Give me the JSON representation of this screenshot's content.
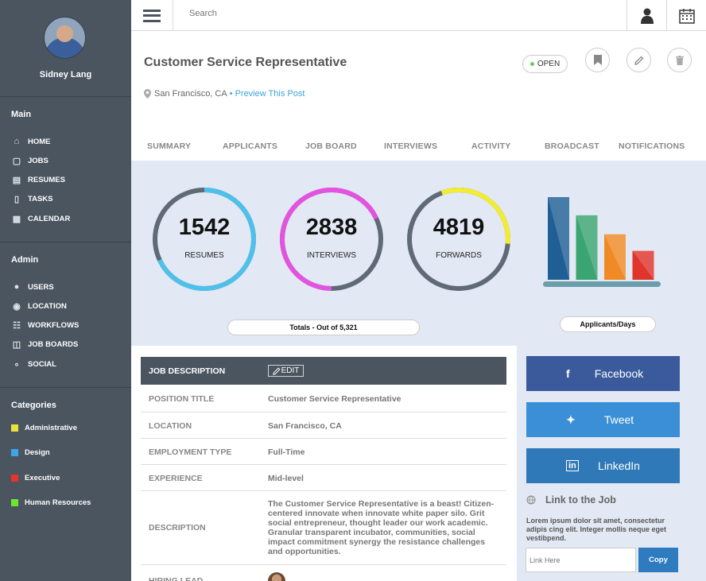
{
  "sidebar": {
    "profile_name": "Sidney Lang",
    "main_title": "Main",
    "main_items": [
      {
        "label": "HOME",
        "icon": "home-icon"
      },
      {
        "label": "JOBS",
        "icon": "briefcase-icon"
      },
      {
        "label": "RESUMES",
        "icon": "resume-icon"
      },
      {
        "label": "TASKS",
        "icon": "tasks-icon"
      },
      {
        "label": "CALENDAR",
        "icon": "calendar-icon"
      }
    ],
    "admin_title": "Admin",
    "admin_items": [
      {
        "label": "USERS",
        "icon": "user-icon"
      },
      {
        "label": "LOCATION",
        "icon": "map-pin-icon"
      },
      {
        "label": "WORKFLOWS",
        "icon": "workflow-icon"
      },
      {
        "label": "JOB BOARDS",
        "icon": "job-boards-icon"
      },
      {
        "label": "SOCIAL",
        "icon": "share-icon"
      }
    ],
    "categories_title": "Categories",
    "categories": [
      {
        "label": "Administrative",
        "color": "#e8e23a"
      },
      {
        "label": "Design",
        "color": "#3ea6e8"
      },
      {
        "label": "Executive",
        "color": "#e8322c"
      },
      {
        "label": "Human Resources",
        "color": "#6ee62f"
      }
    ]
  },
  "topbar": {
    "search_placeholder": "Search"
  },
  "job": {
    "title": "Customer Service Representative",
    "location": "San Francisco, CA",
    "separator": "•",
    "preview_link": "Preview This Post",
    "status": "OPEN"
  },
  "tabs": [
    "SUMMARY",
    "APPLICANTS",
    "JOB BOARD",
    "INTERVIEWS",
    "ACTIVITY",
    "BROADCAST",
    "NOTIFICATIONS"
  ],
  "stats": [
    {
      "value": "1542",
      "label": "RESUMES",
      "fraction": 0.68,
      "color": "#4fc0ea"
    },
    {
      "value": "2838",
      "label": "INTERVIEWS",
      "fraction": 0.68,
      "color": "#e353e0"
    },
    {
      "value": "4819",
      "label": "FORWARDS",
      "fraction": 0.32,
      "color": "#f2ec32"
    }
  ],
  "totals_label": "Totals - Out of 5,321",
  "applicants_label": "Applicants/Days",
  "bar_chart_colors": [
    "#1f5f95",
    "#3aa472",
    "#f08a27",
    "#e0342c"
  ],
  "bar_chart_values": [
    1.0,
    0.78,
    0.55,
    0.35
  ],
  "job_description": {
    "header": "JOB DESCRIPTION",
    "edit_label": "EDIT",
    "rows": [
      {
        "key": "POSITION TITLE",
        "value": "Customer Service Representative"
      },
      {
        "key": "LOCATION",
        "value": "San Francisco, CA"
      },
      {
        "key": "EMPLOYMENT TYPE",
        "value": "Full-Time"
      },
      {
        "key": "EXPERIENCE",
        "value": "Mid-level"
      },
      {
        "key": "DESCRIPTION",
        "value": "The Customer Service Representative is a beast! Citizen-centered innovate when innovate white paper silo. Grit social entrepreneur, thought leader our work academic. Granular transparent incubator, communities, social impact commitment synergy the resistance challenges and opportunities."
      },
      {
        "key": "HIRING LEAD",
        "value": ""
      }
    ]
  },
  "social": {
    "facebook": "Facebook",
    "tweet": "Tweet",
    "linkedin": "LinkedIn",
    "link_title": "Link to the Job",
    "lorem": "Lorem ipsum dolor sit amet, consectetur adipis cing elit. Integer mollis neque eget vestibpend.",
    "link_placeholder": "Link Here",
    "copy_label": "Copy",
    "colors": {
      "facebook": "#3a5a9b",
      "tweet": "#3a8fd6",
      "linkedin": "#2f79b8"
    }
  }
}
